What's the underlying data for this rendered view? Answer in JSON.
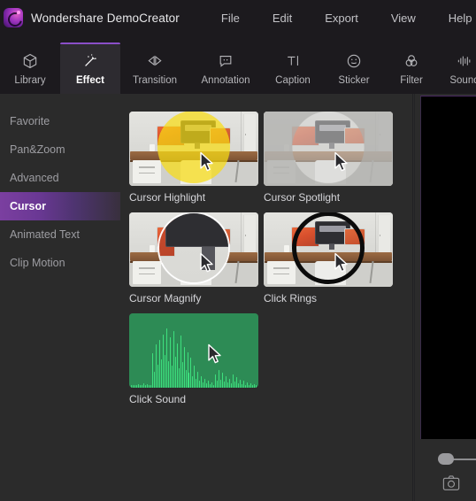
{
  "window": {
    "app_title": "Wondershare DemoCreator",
    "logo_icon": "democreator-logo-icon"
  },
  "menubar": {
    "items": [
      {
        "label": "File"
      },
      {
        "label": "Edit"
      },
      {
        "label": "Export"
      },
      {
        "label": "View"
      },
      {
        "label": "Help"
      }
    ]
  },
  "toolbar": {
    "active_tab": "Effect",
    "tabs": [
      {
        "label": "Library",
        "icon": "cube-icon",
        "active": false
      },
      {
        "label": "Effect",
        "icon": "magic-wand-icon",
        "active": true
      },
      {
        "label": "Transition",
        "icon": "bowtie-icon",
        "active": false
      },
      {
        "label": "Annotation",
        "icon": "speech-bubble-icon",
        "active": false
      },
      {
        "label": "Caption",
        "icon": "text-cursor-icon",
        "active": false
      },
      {
        "label": "Sticker",
        "icon": "smiley-icon",
        "active": false
      },
      {
        "label": "Filter",
        "icon": "three-circles-icon",
        "active": false
      },
      {
        "label": "Sound",
        "icon": "waveform-icon",
        "active": false
      }
    ]
  },
  "sidebar": {
    "selected": "Cursor",
    "items": [
      {
        "label": "Favorite",
        "selected": false
      },
      {
        "label": "Pan&Zoom",
        "selected": false
      },
      {
        "label": "Advanced",
        "selected": false
      },
      {
        "label": "Cursor",
        "selected": true
      },
      {
        "label": "Animated Text",
        "selected": false
      },
      {
        "label": "Clip Motion",
        "selected": false
      }
    ]
  },
  "effects": {
    "items": [
      {
        "name": "Cursor Highlight",
        "style": "highlight"
      },
      {
        "name": "Cursor Spotlight",
        "style": "spotlight"
      },
      {
        "name": "Cursor Magnify",
        "style": "magnify"
      },
      {
        "name": "Click Rings",
        "style": "rings"
      },
      {
        "name": "Click Sound",
        "style": "sound"
      }
    ]
  },
  "preview": {
    "stage_state": "black",
    "slider_icon": "volume-slider-handle",
    "snapshot_icon": "camera-snapshot-icon"
  },
  "colors": {
    "accent_purple": "#8a4fc8",
    "selected_gradient_start": "#7b3fa0",
    "titlebar_bg": "#1c1a1e",
    "panel_bg": "#2b2b2b",
    "highlight_yellow": "#f8dd14",
    "waveform_green": "#3ee07e"
  }
}
